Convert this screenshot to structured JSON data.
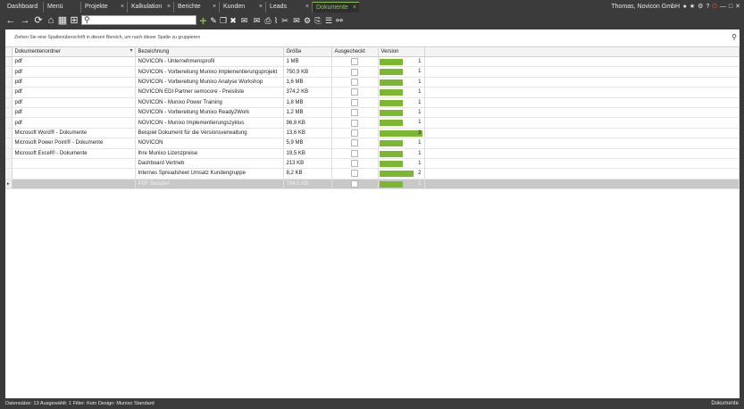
{
  "tabs": [
    {
      "label": "Dashboard",
      "closable": false,
      "active": false
    },
    {
      "label": "Menü",
      "closable": false,
      "active": false
    },
    {
      "label": "Projekte",
      "closable": true,
      "active": false
    },
    {
      "label": "Kalkulation",
      "closable": true,
      "active": false
    },
    {
      "label": "Berichte",
      "closable": true,
      "active": false
    },
    {
      "label": "Kunden",
      "closable": true,
      "active": false
    },
    {
      "label": "Leads",
      "closable": true,
      "active": false
    },
    {
      "label": "Dokumente",
      "closable": true,
      "active": true
    }
  ],
  "close_glyph": "×",
  "user": {
    "name": "Thomas, Novicon GmbH"
  },
  "toolbar": {
    "search_value": "",
    "icons": {
      "back": "←",
      "forward": "→",
      "refresh": "⟳",
      "home": "⌂",
      "calendar": "▦",
      "grid": "⊞",
      "search": "⚲",
      "add": "+",
      "edit": "✎",
      "copy": "❐",
      "delete": "✖",
      "mail": "✉",
      "mail_send": "✉",
      "print": "⎙",
      "attach": "⌇",
      "cut": "✂",
      "mail_open": "✉",
      "scan": "⚙",
      "export": "⎘",
      "list": "☰",
      "link": "⚯"
    }
  },
  "grid": {
    "group_hint": "Ziehen Sie eine Spaltenüberschrift in diesen Bereich, um nach dieser Spalte zu gruppieren",
    "filter_glyph": "▾",
    "columns": [
      "Dokumentenordner",
      "Bezeichnung",
      "Größe",
      "Ausgecheckt",
      "Version"
    ],
    "rows": [
      {
        "folder": "pdf",
        "name": "NOVICON - Unternehmensprofil",
        "size": "1 MB",
        "version": "1",
        "bar": 0.55
      },
      {
        "folder": "pdf",
        "name": "NOVICON - Vorbereitung Munixo Implementierungsprojekt",
        "size": "750,9 KB",
        "version": "1",
        "bar": 0.55
      },
      {
        "folder": "pdf",
        "name": "NOVICON - Vorbereitung Munixo Analyse Workshop",
        "size": "1,6 MB",
        "version": "1",
        "bar": 0.55
      },
      {
        "folder": "pdf",
        "name": "NOVICON EDI Partner semocore - Preisliste",
        "size": "374,2 KB",
        "version": "1",
        "bar": 0.55
      },
      {
        "folder": "pdf",
        "name": "NOVICON - Munixo Power Training",
        "size": "1,8 MB",
        "version": "1",
        "bar": 0.55
      },
      {
        "folder": "pdf",
        "name": "NOVICON - Vorbereitung Munixo Ready2Work",
        "size": "1,2 MB",
        "version": "1",
        "bar": 0.55
      },
      {
        "folder": "pdf",
        "name": "NOVICON - Munixo Implementierungszyklus",
        "size": "96,8 KB",
        "version": "1",
        "bar": 0.55
      },
      {
        "folder": "Microsoft Word® - Dokumente",
        "name": "Beispiel Dokument für die Versionsverwaltung",
        "size": "13,6 KB",
        "version": "3",
        "bar": 1.0
      },
      {
        "folder": "Microsoft Power Point® - Dokumente",
        "name": "NOVICON",
        "size": "5,9 MB",
        "version": "1",
        "bar": 0.55
      },
      {
        "folder": "Microsoft Excel® - Dokumente",
        "name": "Ihre Munixo Lizenzpreise",
        "size": "19,5 KB",
        "version": "1",
        "bar": 0.55
      },
      {
        "folder": "",
        "name": "Dashboard Vertrieb",
        "size": "213 KB",
        "version": "1",
        "bar": 0.55
      },
      {
        "folder": "",
        "name": "Internes Spreadsheet Umsatz Kundengruppe",
        "size": "8,2 KB",
        "version": "2",
        "bar": 0.8
      },
      {
        "folder": "",
        "name": "PDF Beispiel",
        "size": "784,5 KB",
        "version": "1",
        "bar": 0.55,
        "selected": true,
        "indicator": "▸"
      }
    ]
  },
  "status": {
    "left": "Datensätze: 13 Ausgewählt: 1 Filter: Kein Design: Munixo Standard",
    "right": "Dokumente"
  },
  "colors": {
    "accent": "#8bc34a",
    "version_bar": "#7cb82f",
    "chrome": "#3b3b3b",
    "selected_row": "#c8c8c8"
  }
}
